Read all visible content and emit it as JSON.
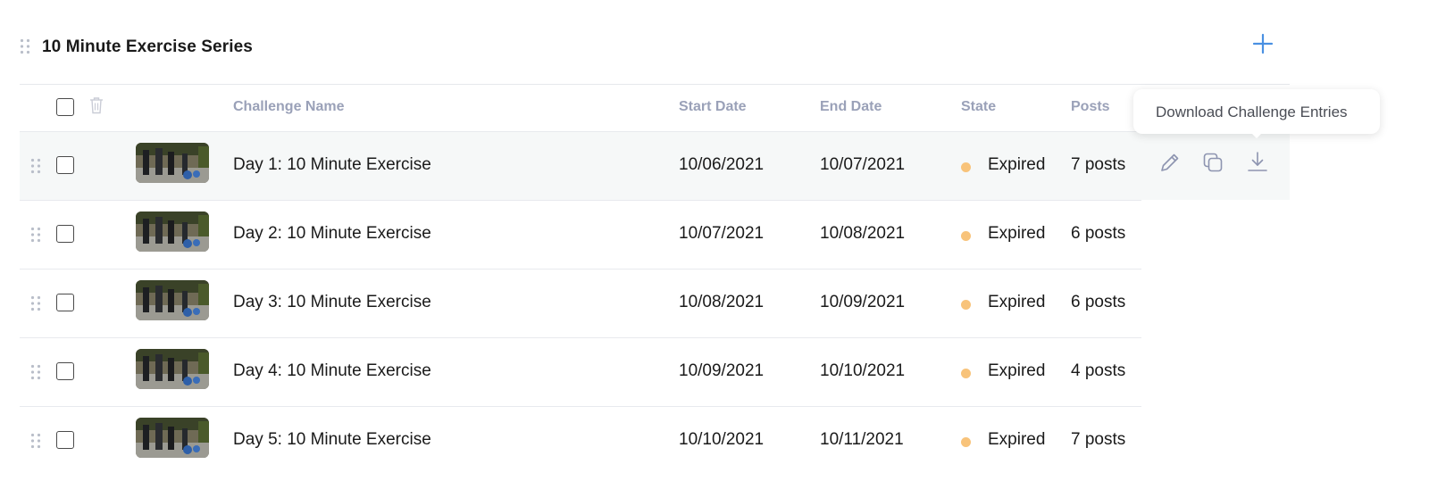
{
  "series": {
    "title": "10 Minute Exercise Series"
  },
  "table": {
    "headers": {
      "name": "Challenge Name",
      "start": "Start Date",
      "end": "End Date",
      "state": "State",
      "posts": "Posts"
    },
    "rows": [
      {
        "name": "Day 1: 10 Minute Exercise",
        "start": "10/06/2021",
        "end": "10/07/2021",
        "state": "Expired",
        "posts": "7 posts"
      },
      {
        "name": "Day 2: 10 Minute Exercise",
        "start": "10/07/2021",
        "end": "10/08/2021",
        "state": "Expired",
        "posts": "6 posts"
      },
      {
        "name": "Day 3: 10 Minute Exercise",
        "start": "10/08/2021",
        "end": "10/09/2021",
        "state": "Expired",
        "posts": "6 posts"
      },
      {
        "name": "Day 4: 10 Minute Exercise",
        "start": "10/09/2021",
        "end": "10/10/2021",
        "state": "Expired",
        "posts": "4 posts"
      },
      {
        "name": "Day 5: 10 Minute Exercise",
        "start": "10/10/2021",
        "end": "10/11/2021",
        "state": "Expired",
        "posts": "7 posts"
      }
    ]
  },
  "tooltip": {
    "text": "Download Challenge Entries"
  },
  "icons": {
    "add": "plus-icon",
    "trash": "trash-icon",
    "drag": "drag-handle-icon",
    "edit": "pencil-icon",
    "duplicate": "duplicate-icon",
    "download": "download-icon"
  },
  "colors": {
    "accent": "#4a90e2",
    "header_text": "#9aa1b8",
    "expired_dot": "#f8c37a",
    "active_row_bg": "#f6f8f8",
    "icon": "#8d94b0"
  }
}
